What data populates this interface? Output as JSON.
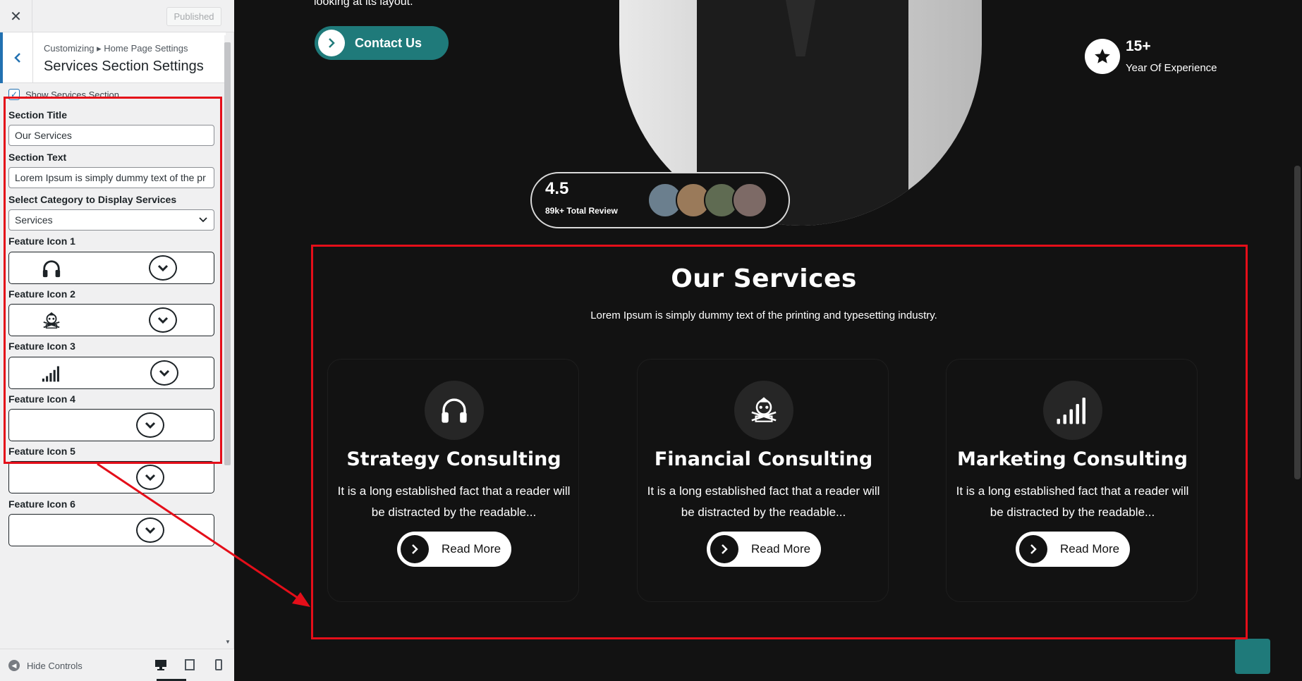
{
  "sidebar": {
    "close_icon": "✕",
    "published_label": "Published",
    "breadcrumb": "Customizing ▸ Home Page Settings",
    "title": "Services Section Settings",
    "show_services_label": "Show Services Section",
    "show_services_checked": true,
    "section_title_label": "Section Title",
    "section_title_value": "Our Services",
    "section_text_label": "Section Text",
    "section_text_value": "Lorem Ipsum is simply dummy text of the pr",
    "category_label": "Select Category to Display Services",
    "category_value": "Services",
    "feature_icons": [
      {
        "label": "Feature Icon 1",
        "icon": "headphones-icon"
      },
      {
        "label": "Feature Icon 2",
        "icon": "pirate-emblem-icon"
      },
      {
        "label": "Feature Icon 3",
        "icon": "signal-bars-icon"
      },
      {
        "label": "Feature Icon 4",
        "icon": ""
      },
      {
        "label": "Feature Icon 5",
        "icon": ""
      },
      {
        "label": "Feature Icon 6",
        "icon": ""
      }
    ],
    "hide_controls_label": "Hide Controls"
  },
  "preview": {
    "hero_text": "looking at its layout.",
    "contact_label": "Contact Us",
    "rating": "4.5",
    "review_label": "89k+ Total Review",
    "experience_value": "15+",
    "experience_label": "Year Of Experience",
    "services_title": "Our Services",
    "services_text": "Lorem Ipsum is simply dummy text of the printing and typesetting industry.",
    "cards": [
      {
        "title": "Strategy Consulting",
        "text": "It is a long established fact that a reader will be distracted by the readable...",
        "button": "Read More",
        "icon": "headphones-icon"
      },
      {
        "title": "Financial Consulting",
        "text": "It is a long established fact that a reader will be distracted by the readable...",
        "button": "Read More",
        "icon": "pirate-emblem-icon"
      },
      {
        "title": "Marketing Consulting",
        "text": "It is a long established fact that a reader will be distracted by the readable...",
        "button": "Read More",
        "icon": "signal-bars-icon"
      }
    ]
  },
  "colors": {
    "accent": "#1f7a7a",
    "highlight": "#e40e19",
    "wp_blue": "#2271b1",
    "background": "#121212"
  }
}
